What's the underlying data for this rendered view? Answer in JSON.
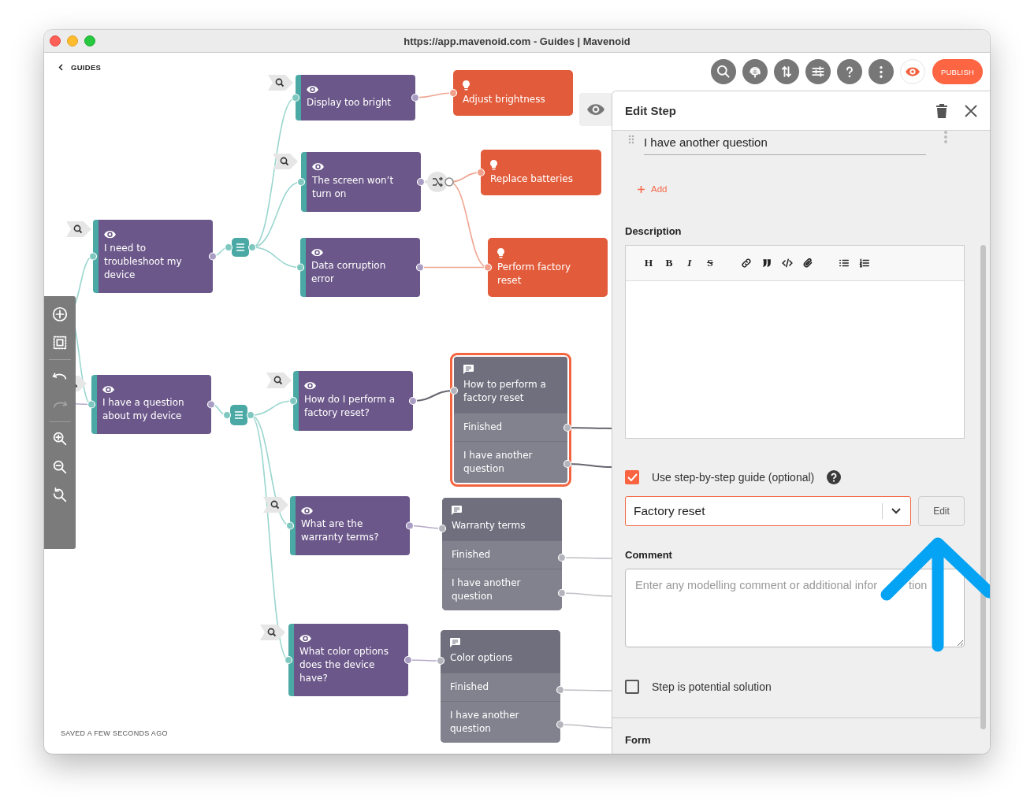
{
  "window": {
    "title": "https://app.mavenoid.com - Guides | Mavenoid"
  },
  "nav": {
    "back": "GUIDES"
  },
  "toolbar": {
    "preview_on": true,
    "publish": "PUBLISH"
  },
  "canvas": {
    "questions": [
      {
        "text": "Display too bright"
      },
      {
        "text": "The screen won’t turn on"
      },
      {
        "text": "I need to troubleshoot my device"
      },
      {
        "text": "Data corruption error"
      },
      {
        "text": "I have a question about my device"
      },
      {
        "text": "How do I perform a factory reset?"
      },
      {
        "text": "What are the warranty terms?"
      },
      {
        "text": "What color options does the device have?"
      }
    ],
    "solutions": [
      {
        "text": "Adjust brightness"
      },
      {
        "text": "Replace batteries"
      },
      {
        "text": "Perform factory reset"
      }
    ],
    "guides": [
      {
        "title": "How to perform a factory reset",
        "rows": [
          "Finished",
          "I have another question"
        ],
        "selected": true
      },
      {
        "title": "Warranty terms",
        "rows": [
          "Finished",
          "I have another question"
        ],
        "selected": false
      },
      {
        "title": "Color options",
        "rows": [
          "Finished",
          "I have another question"
        ],
        "selected": false
      }
    ],
    "status": "SAVED A FEW SECONDS AGO"
  },
  "panel": {
    "title": "Edit Step",
    "answer": "I have another question",
    "add": "Add",
    "description_label": "Description",
    "editor_tools": [
      {
        "kind": "heading",
        "glyph": "H"
      },
      {
        "kind": "bold",
        "glyph": "B"
      },
      {
        "kind": "italic",
        "glyph": "I"
      },
      {
        "kind": "strike",
        "glyph": "S"
      }
    ],
    "use_guide": {
      "label": "Use step-by-step guide (optional)",
      "checked": true
    },
    "guide_select": "Factory reset",
    "edit": "Edit",
    "comment_label": "Comment",
    "comment_placeholder": "Enter any modelling comment or additional infor",
    "comment_placeholder_tail": "tion",
    "potential_solution": {
      "label": "Step is potential solution",
      "checked": false
    },
    "form_label": "Form"
  }
}
